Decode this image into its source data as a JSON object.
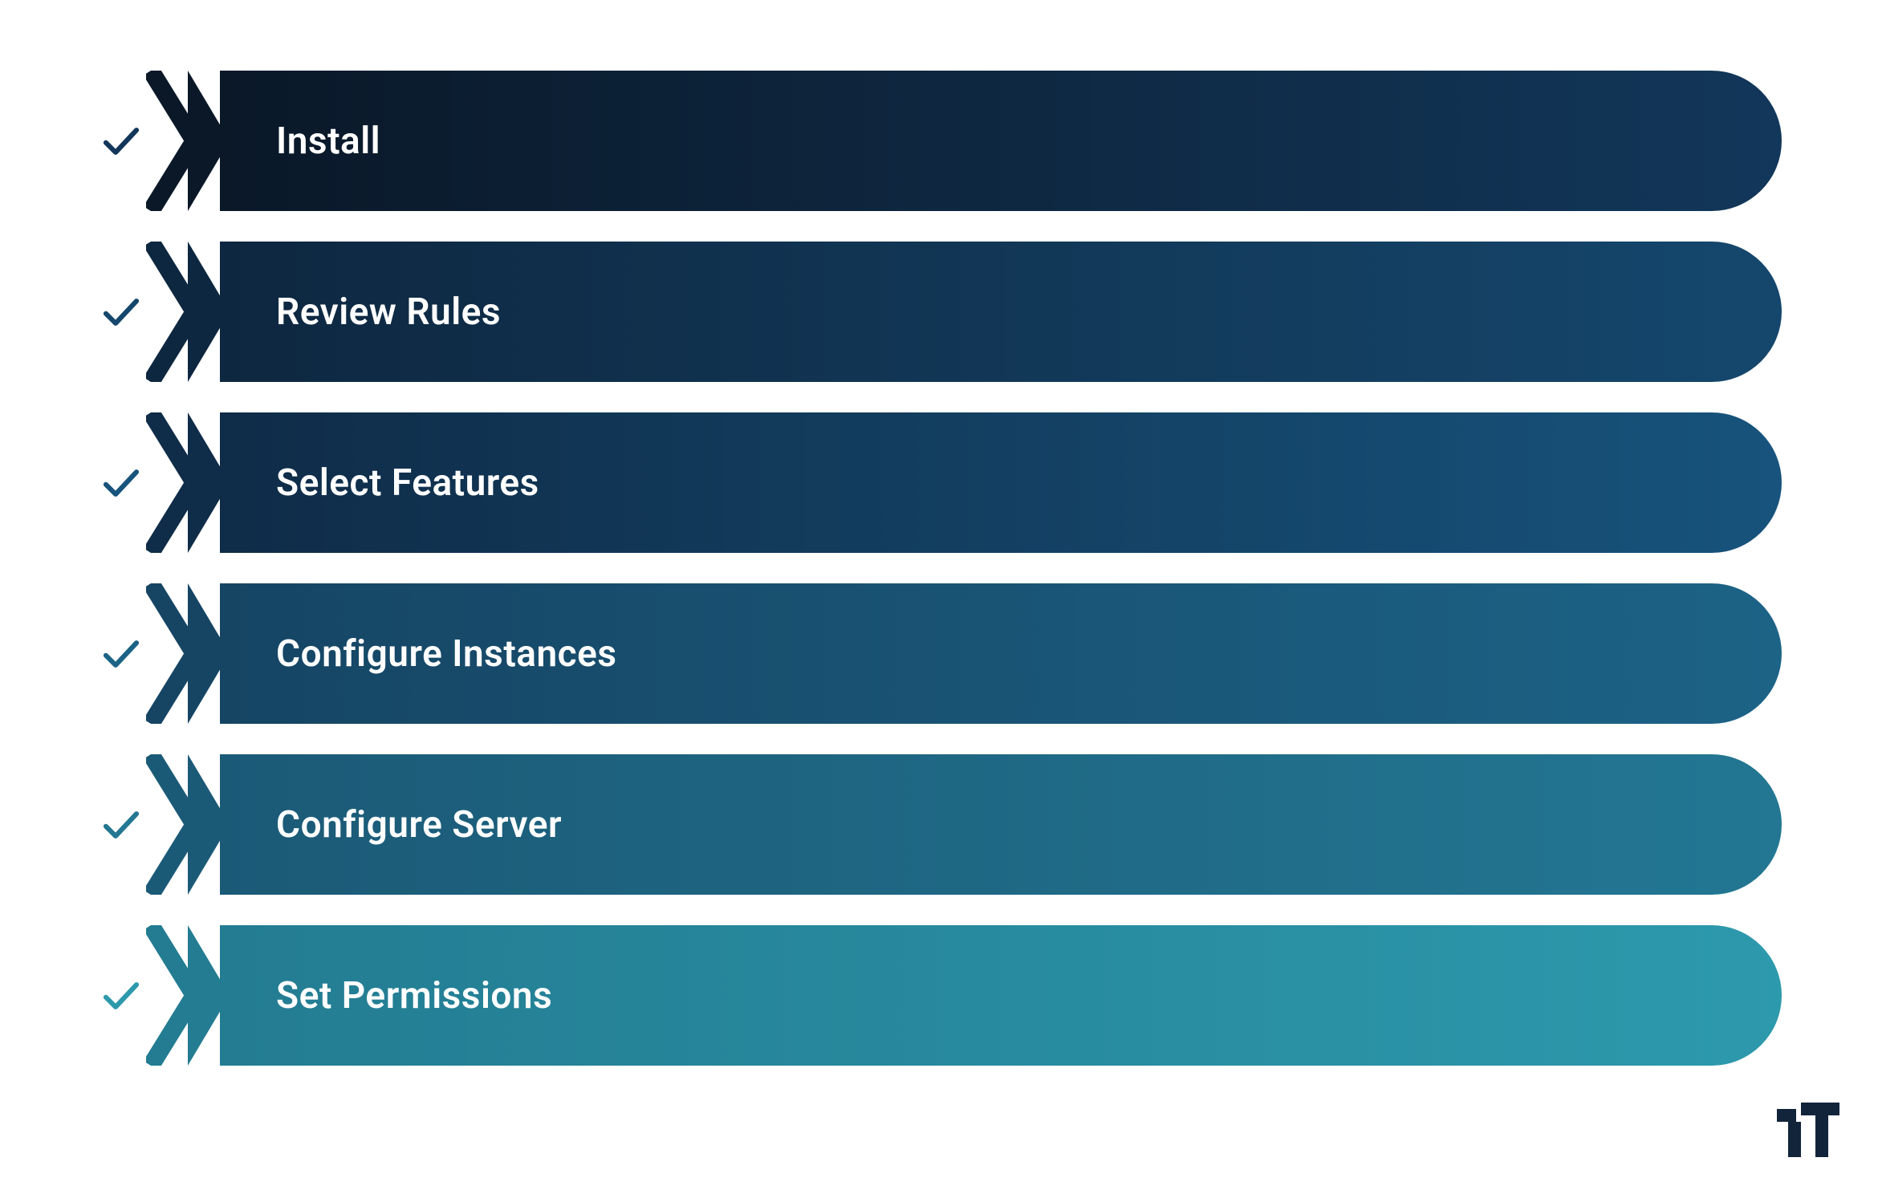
{
  "steps": [
    {
      "label": "Install",
      "color_start": "#0a1828",
      "color_end": "#12375a",
      "chevron_color": "#0a1828",
      "check_color": "#12375a"
    },
    {
      "label": "Review Rules",
      "color_start": "#0e2740",
      "color_end": "#15476d",
      "chevron_color": "#0e2740",
      "check_color": "#15476d"
    },
    {
      "label": "Select Features",
      "color_start": "#0f2c48",
      "color_end": "#17537c",
      "chevron_color": "#0f2c48",
      "check_color": "#17537c"
    },
    {
      "label": "Configure Instances",
      "color_start": "#164564",
      "color_end": "#1c6386",
      "chevron_color": "#164564",
      "check_color": "#1c6386"
    },
    {
      "label": "Configure Server",
      "color_start": "#1b5a77",
      "color_end": "#237793",
      "chevron_color": "#1b5a77",
      "check_color": "#237793"
    },
    {
      "label": "Set Permissions",
      "color_start": "#237c92",
      "color_end": "#2d99ac",
      "chevron_color": "#237c92",
      "check_color": "#2d99ac"
    }
  ],
  "logo_color": "#12243a"
}
